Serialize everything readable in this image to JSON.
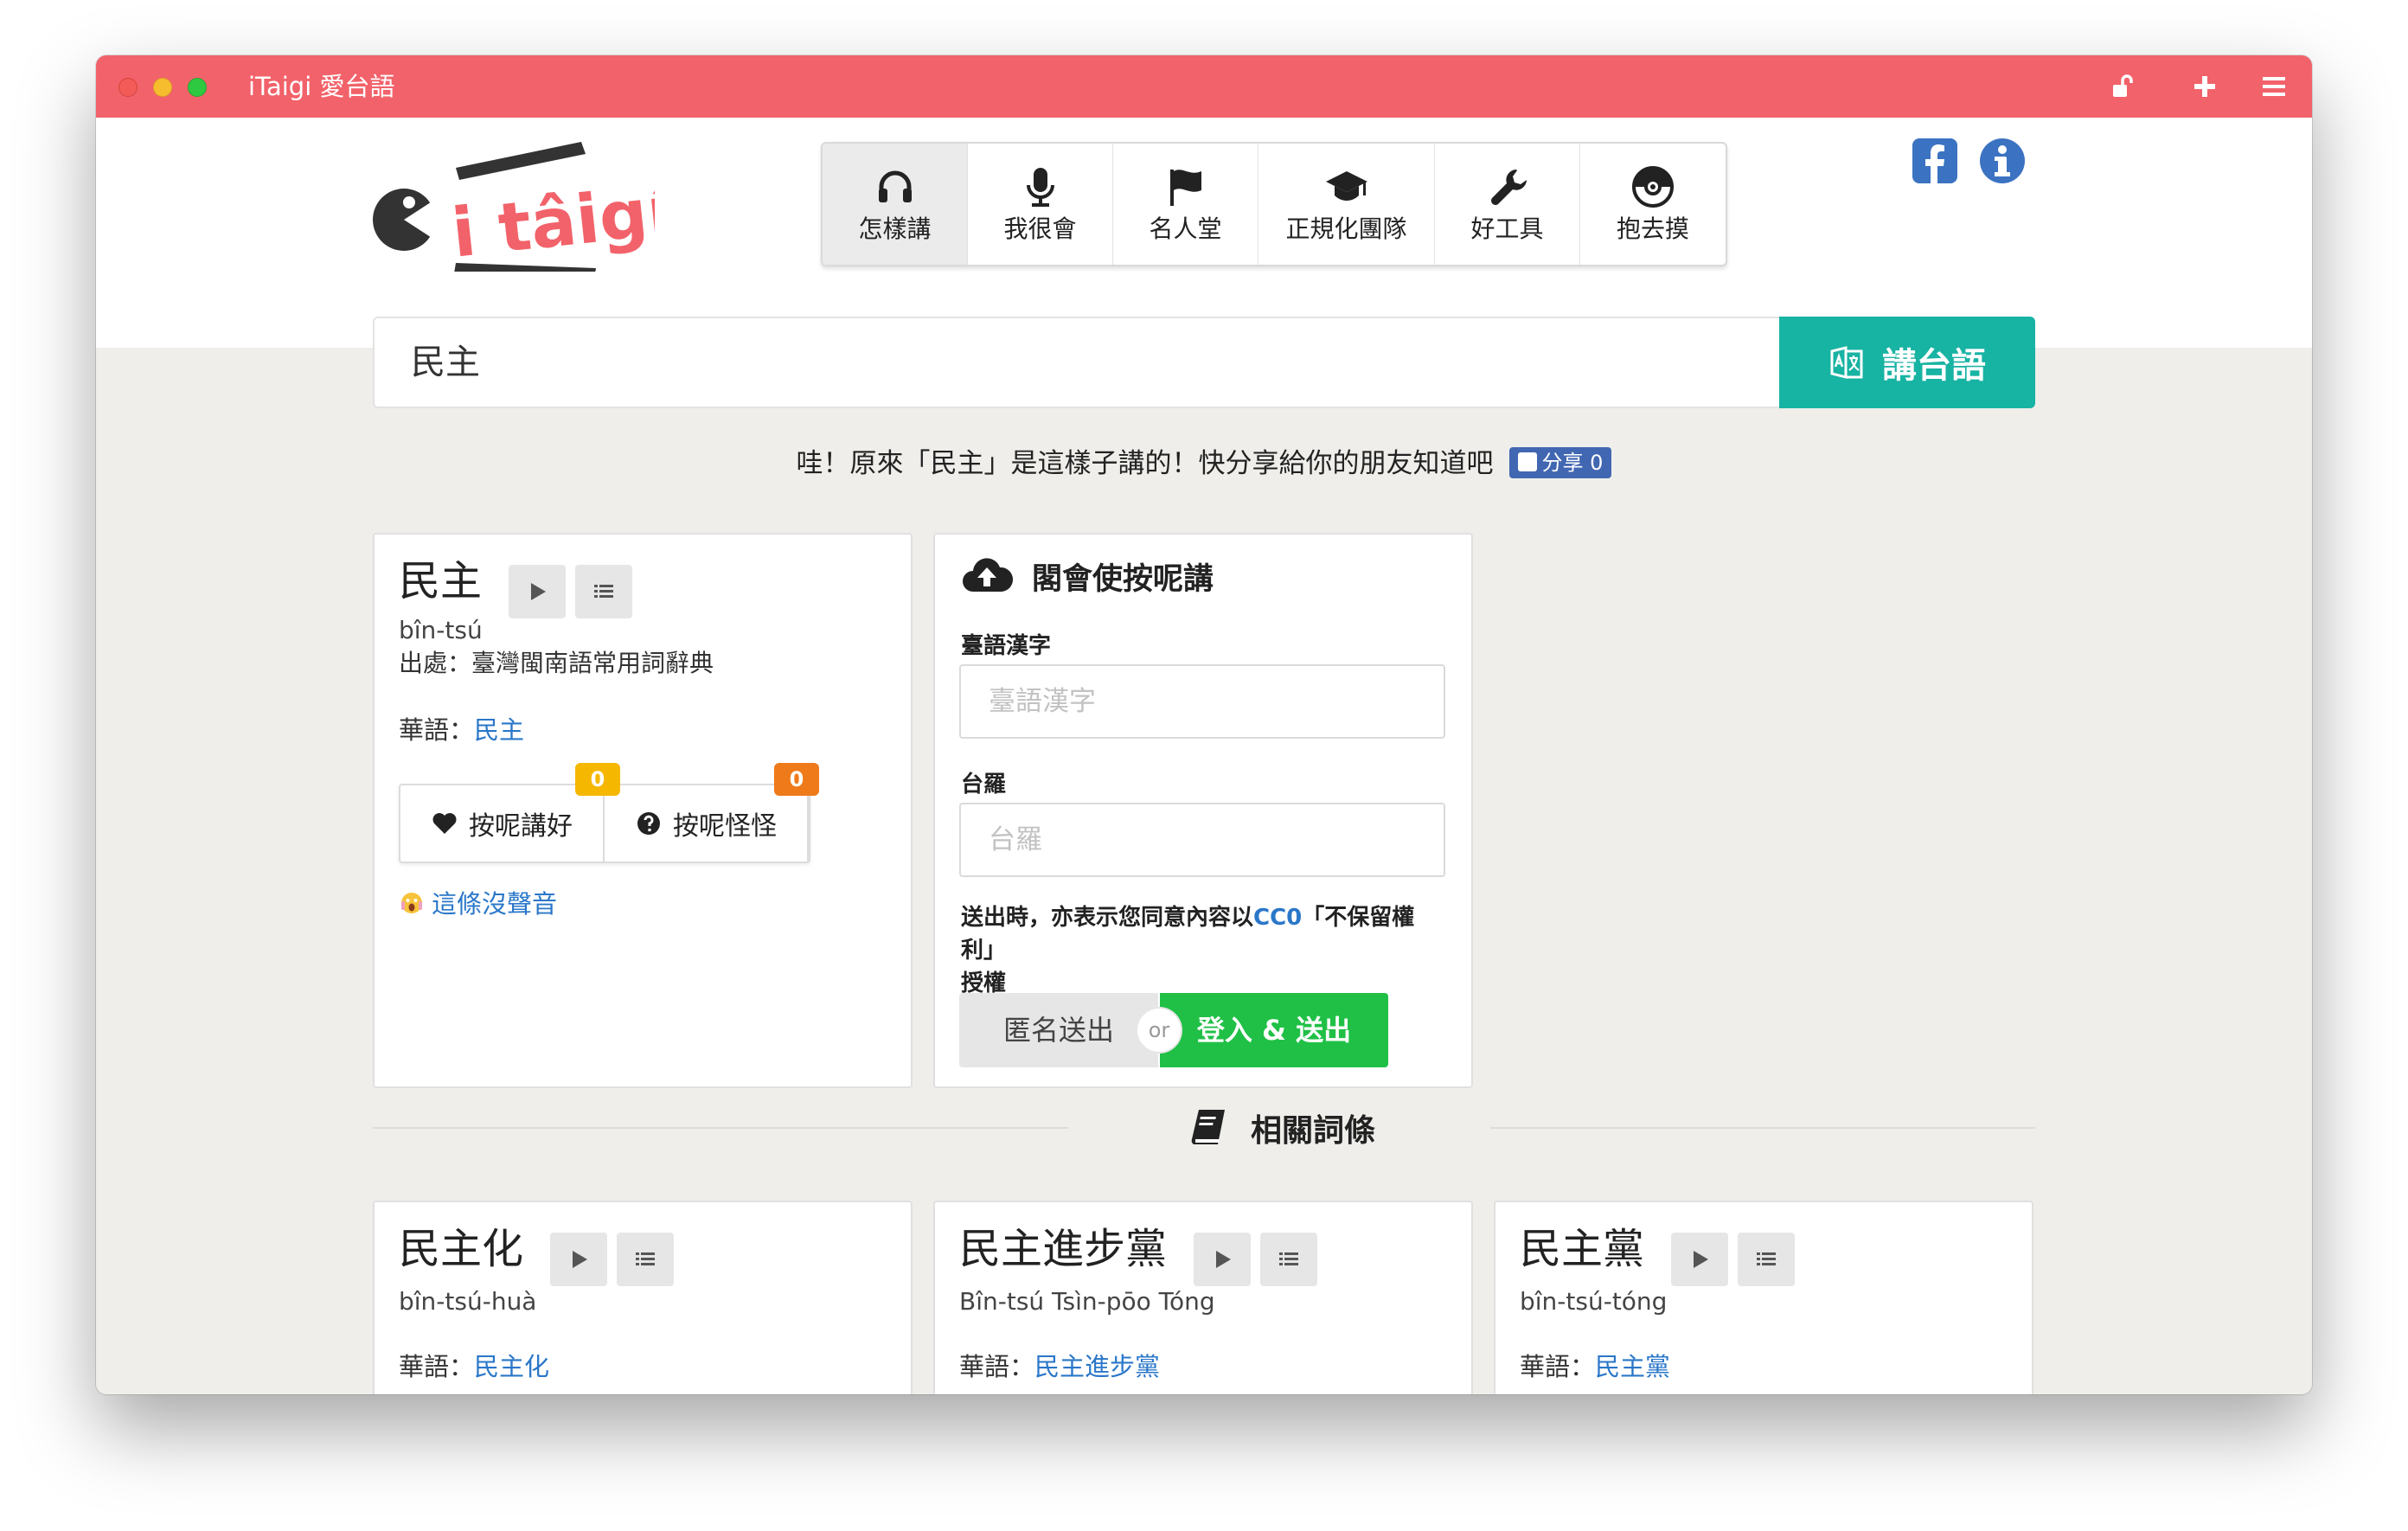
{
  "window": {
    "title": "iTaigi 愛台語"
  },
  "logo": {
    "text": "i tâigí"
  },
  "nav": {
    "items": [
      {
        "label": "怎樣講",
        "icon": "headphones-icon"
      },
      {
        "label": "我很會",
        "icon": "microphone-icon"
      },
      {
        "label": "名人堂",
        "icon": "flag-icon"
      },
      {
        "label": "正規化團隊",
        "icon": "graduation-cap-icon"
      },
      {
        "label": "好工具",
        "icon": "wrench-icon"
      },
      {
        "label": "抱去摸",
        "icon": "pokeball-icon"
      }
    ]
  },
  "search": {
    "value": "民主",
    "button_label": "講台語"
  },
  "share": {
    "text": "哇！原來「民主」是這樣子講的！快分享給你的朋友知道吧",
    "button_label": "分享 0"
  },
  "main_entry": {
    "word": "民主",
    "romanization": "bîn-tsú",
    "source": "出處：臺灣閩南語常用詞辭典",
    "mandarin_prefix": "華語：",
    "mandarin_link": "民主",
    "like_label": "按呢講好",
    "like_count": "0",
    "odd_label": "按呢怪怪",
    "odd_count": "0",
    "no_sound": "這條沒聲音"
  },
  "submit_form": {
    "title": "閣會使按呢講",
    "hanzi_label": "臺語漢字",
    "hanzi_placeholder": "臺語漢字",
    "tailo_label": "台羅",
    "tailo_placeholder": "台羅",
    "notice_prefix": "送出時，亦表示您同意內容以",
    "notice_link": "CC0",
    "notice_suffix": "「不保留權利」",
    "notice_line2": "授權",
    "anon_button": "匿名送出",
    "or_text": "or",
    "login_button": "登入 & 送出"
  },
  "related": {
    "heading": "相關詞條",
    "entries": [
      {
        "word": "民主化",
        "romanization": "bîn-tsú-huà",
        "mandarin_prefix": "華語：",
        "mandarin_link": "民主化"
      },
      {
        "word": "民主進步黨",
        "romanization": "Bîn-tsú Tsìn-pōo Tóng",
        "mandarin_prefix": "華語：",
        "mandarin_link": "民主進步黨"
      },
      {
        "word": "民主黨",
        "romanization": "bîn-tsú-tóng",
        "mandarin_prefix": "華語：",
        "mandarin_link": "民主黨"
      }
    ]
  },
  "colors": {
    "titlebar": "#f2626a",
    "accent_teal": "#17b3a3",
    "link_blue": "#2a77c9",
    "login_green": "#20c046",
    "badge_yellow": "#f6b700",
    "badge_orange": "#ef7a1a",
    "facebook_blue": "#4267b2"
  }
}
